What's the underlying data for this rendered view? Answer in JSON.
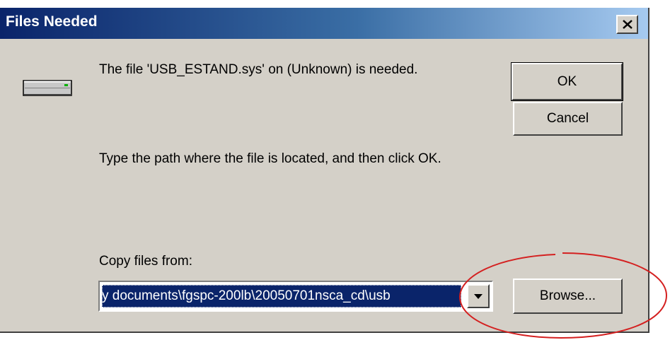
{
  "window": {
    "title": "Files Needed"
  },
  "icons": {
    "close": "close-icon",
    "drive": "drive-icon",
    "dropdown": "chevron-down-icon"
  },
  "message": {
    "line1": "The file 'USB_ESTAND.sys' on (Unknown) is needed.",
    "line2": "Type the path where the file is located, and then click OK.",
    "copy_label": "Copy files from:"
  },
  "buttons": {
    "ok": "OK",
    "cancel": "Cancel",
    "browse": "Browse..."
  },
  "copy_from": {
    "value": "y documents\\fgspc-200lb\\20050701nsca_cd\\usb"
  },
  "colors": {
    "title_gradient_start": "#0a246a",
    "title_gradient_end": "#a6caf0",
    "dialog_face": "#d4d0c8",
    "selection": "#0a246a",
    "annotation_circle": "#d42020"
  }
}
